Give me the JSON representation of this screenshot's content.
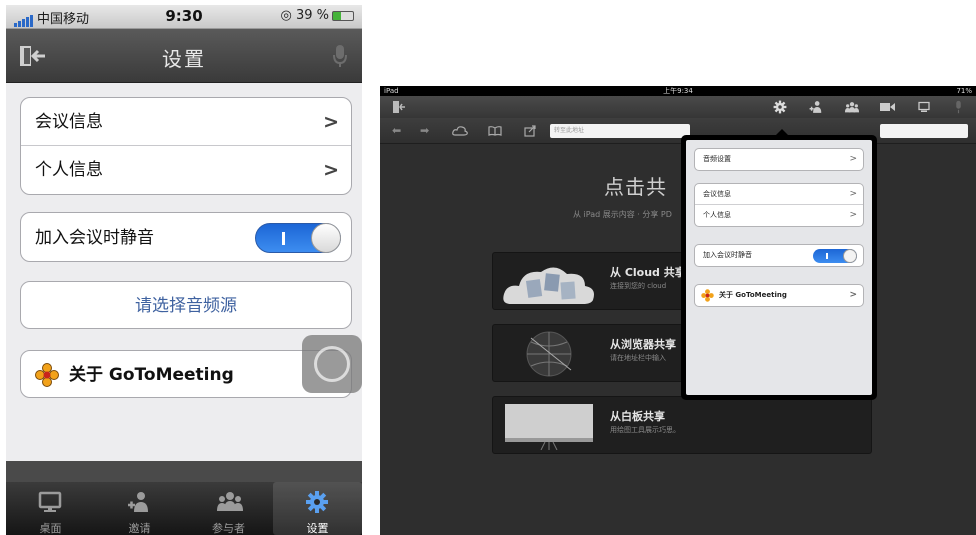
{
  "phone": {
    "status": {
      "carrier": "中国移动",
      "time": "9:30",
      "battery": "39 %"
    },
    "nav": {
      "title": "设置"
    },
    "info_rows": [
      {
        "label": "会议信息"
      },
      {
        "label": "个人信息"
      }
    ],
    "mute": {
      "label": "加入会议时静音",
      "on": true
    },
    "audio_button": "请选择音频源",
    "about": {
      "label": "关于 GoToMeeting"
    },
    "tabs": [
      {
        "label": "桌面",
        "icon": "desktop-icon"
      },
      {
        "label": "邀请",
        "icon": "invite-icon"
      },
      {
        "label": "参与者",
        "icon": "participants-icon"
      },
      {
        "label": "设置",
        "icon": "gear-icon",
        "active": true
      }
    ]
  },
  "ipad": {
    "status": {
      "left": "iPad",
      "time": "上午9:34",
      "battery": "71%"
    },
    "url_placeholder": "转至此地址",
    "heading": "点击共",
    "subheading": "从 iPad 展示内容 · 分享 PD",
    "cards": [
      {
        "title": "从 Cloud 共享",
        "sub": "连接到您的 cloud"
      },
      {
        "title": "从浏览器共享",
        "sub": "请在地址栏中输入"
      },
      {
        "title": "从白板共享",
        "sub": "用绘图工具展示巧思。"
      }
    ],
    "popover": {
      "audio_settings": "音频设置",
      "meeting_info": "会议信息",
      "personal_info": "个人信息",
      "mute_label": "加入会议时静音",
      "about": "关于 GoToMeeting"
    }
  },
  "colors": {
    "accent_blue": "#2f7ae5",
    "link_blue": "#3f62a0"
  }
}
